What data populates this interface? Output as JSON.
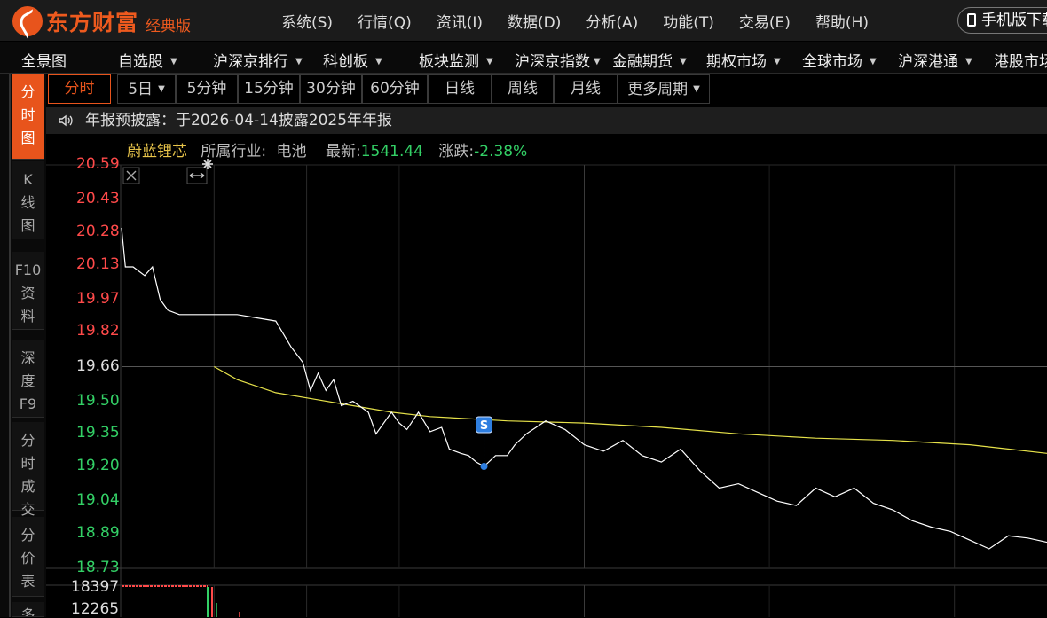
{
  "app": {
    "brand": "东方财富",
    "edition": "经典版",
    "menu": [
      "系统(S)",
      "行情(Q)",
      "资讯(I)",
      "数据(D)",
      "分析(A)",
      "功能(T)",
      "交易(E)",
      "帮助(H)"
    ],
    "mobile_button": "手机版下载"
  },
  "nav": [
    {
      "label": "全景图",
      "caret": false
    },
    {
      "label": "自选股",
      "caret": true
    },
    {
      "label": "沪深京排行",
      "caret": true
    },
    {
      "label": "科创板",
      "caret": true
    },
    {
      "label": "板块监测",
      "caret": true
    },
    {
      "label": "沪深京指数",
      "caret": true
    },
    {
      "label": "金融期货",
      "caret": true
    },
    {
      "label": "期权市场",
      "caret": true
    },
    {
      "label": "全球市场",
      "caret": true
    },
    {
      "label": "沪深港通",
      "caret": true
    },
    {
      "label": "港股市场",
      "caret": false
    }
  ],
  "left_tabs": [
    {
      "label": "分时图",
      "active": true
    },
    {
      "label": "K线图",
      "active": false
    },
    {
      "label": "F10资料",
      "active": false
    },
    {
      "label": "深度F9",
      "active": false
    },
    {
      "label": "分时成交",
      "active": false
    },
    {
      "label": "分价表",
      "active": false
    },
    {
      "label": "多",
      "active": false
    }
  ],
  "periods": [
    {
      "label": "分时",
      "active": true,
      "caret": false
    },
    {
      "label": "5日",
      "active": false,
      "caret": true
    },
    {
      "label": "5分钟",
      "active": false,
      "caret": false
    },
    {
      "label": "15分钟",
      "active": false,
      "caret": false
    },
    {
      "label": "30分钟",
      "active": false,
      "caret": false
    },
    {
      "label": "60分钟",
      "active": false,
      "caret": false
    },
    {
      "label": "日线",
      "active": false,
      "caret": false
    },
    {
      "label": "周线",
      "active": false,
      "caret": false
    },
    {
      "label": "月线",
      "active": false,
      "caret": false
    },
    {
      "label": "更多周期",
      "active": false,
      "caret": true
    }
  ],
  "notice": "年报预披露：于2026-04-14披露2025年年报",
  "stock": {
    "name": "蔚蓝锂芯",
    "industry_label": "所属行业:",
    "industry": "电池",
    "latest_label": "最新:",
    "latest": "1541.44",
    "change_label": "涨跌:",
    "change": "-2.38%"
  },
  "marker_label": "S",
  "colors": {
    "up": "#ff4a4a",
    "down": "#33d066",
    "price_line": "#ffffff",
    "avg_line": "#e6e24a",
    "accent": "#e8541c",
    "marker": "#2e7ee0"
  },
  "chart_data": {
    "type": "line",
    "prev_close": 19.66,
    "ylim": [
      18.73,
      20.59
    ],
    "y_ticks": [
      "20.59",
      "20.43",
      "20.28",
      "20.13",
      "19.97",
      "19.82",
      "19.66",
      "19.50",
      "19.35",
      "19.20",
      "19.04",
      "18.89",
      "18.73"
    ],
    "y_tick_values": [
      20.59,
      20.43,
      20.28,
      20.13,
      19.97,
      19.82,
      19.66,
      19.5,
      19.35,
      19.2,
      19.04,
      18.89,
      18.73
    ],
    "x_minutes_total": 240,
    "series": [
      {
        "key": "price",
        "x": [
          0,
          1,
          3,
          6,
          8,
          10,
          12,
          15,
          18,
          22,
          30,
          40,
          44,
          47,
          49,
          51,
          53,
          55,
          57,
          60,
          64,
          66,
          70,
          72,
          74,
          77,
          80,
          83,
          85,
          88,
          90,
          92,
          94,
          97,
          100,
          102,
          105,
          110,
          115,
          120,
          125,
          130,
          135,
          140,
          145,
          150,
          155,
          160,
          165,
          170,
          175,
          180,
          185,
          190,
          195,
          200,
          205,
          210,
          215,
          220,
          225,
          230,
          235,
          240
        ],
        "y": [
          20.3,
          20.12,
          20.12,
          20.08,
          20.12,
          19.97,
          19.92,
          19.9,
          19.9,
          19.9,
          19.9,
          19.87,
          19.75,
          19.68,
          19.55,
          19.63,
          19.55,
          19.6,
          19.48,
          19.5,
          19.45,
          19.35,
          19.45,
          19.4,
          19.37,
          19.45,
          19.36,
          19.38,
          19.28,
          19.26,
          19.25,
          19.22,
          19.2,
          19.25,
          19.25,
          19.3,
          19.35,
          19.41,
          19.37,
          19.3,
          19.27,
          19.32,
          19.25,
          19.22,
          19.28,
          19.18,
          19.1,
          19.12,
          19.08,
          19.04,
          19.02,
          19.1,
          19.06,
          19.1,
          19.03,
          19.0,
          18.95,
          18.92,
          18.9,
          18.86,
          18.82,
          18.88,
          18.87,
          18.85
        ]
      },
      {
        "key": "average",
        "x": [
          24,
          30,
          40,
          50,
          60,
          70,
          80,
          90,
          100,
          120,
          140,
          160,
          180,
          200,
          220,
          240
        ],
        "y": [
          19.66,
          19.6,
          19.54,
          19.51,
          19.48,
          19.45,
          19.43,
          19.42,
          19.41,
          19.4,
          19.38,
          19.35,
          19.33,
          19.32,
          19.3,
          19.26
        ]
      }
    ],
    "volume": {
      "y_ticks": [
        "18397",
        "12265"
      ]
    }
  }
}
